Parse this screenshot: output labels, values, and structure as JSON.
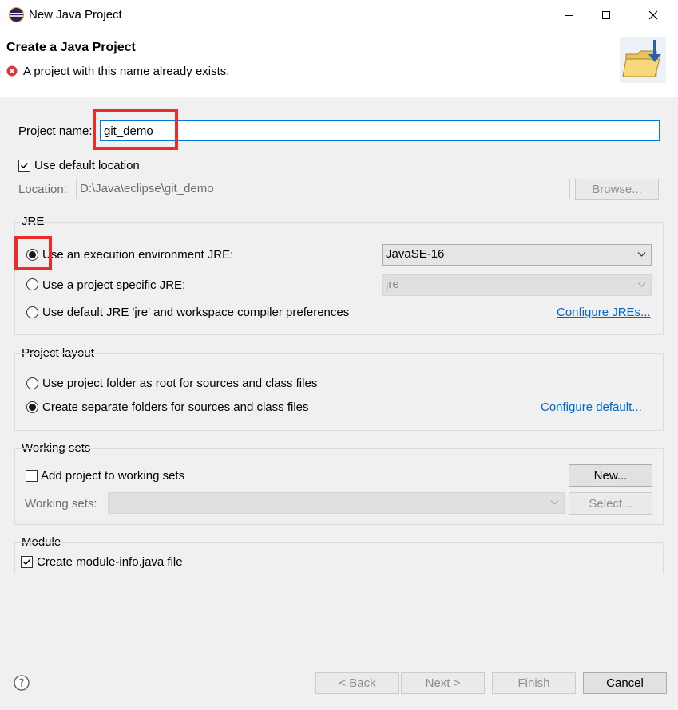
{
  "window": {
    "title": "New Java Project",
    "minimize_icon": "minimize-icon",
    "maximize_icon": "maximize-icon",
    "close_icon": "close-icon"
  },
  "banner": {
    "title": "Create a Java Project",
    "message": "A project with this name already exists.",
    "message_icon": "error-icon",
    "image_icon": "folder-wizard-icon"
  },
  "project": {
    "name_label": "Project name:",
    "name_value": "git_demo",
    "use_default_location_label": "Use default location",
    "use_default_location_checked": true,
    "location_label": "Location:",
    "location_value": "D:\\Java\\eclipse\\git_demo",
    "browse_label": "Browse..."
  },
  "jre": {
    "group_title": "JRE",
    "options": [
      {
        "label": "Use an execution environment JRE:",
        "selected": true
      },
      {
        "label": "Use a project specific JRE:",
        "selected": false
      },
      {
        "label": "Use default JRE 'jre' and workspace compiler preferences",
        "selected": false
      }
    ],
    "execution_env_value": "JavaSE-16",
    "project_specific_value": "jre",
    "configure_link": "Configure JREs..."
  },
  "layout": {
    "group_title": "Project layout",
    "options": [
      {
        "label": "Use project folder as root for sources and class files",
        "selected": false
      },
      {
        "label": "Create separate folders for sources and class files",
        "selected": true
      }
    ],
    "configure_link": "Configure default..."
  },
  "working_sets": {
    "group_title": "Working sets",
    "add_label": "Add project to working sets",
    "add_checked": false,
    "new_label": "New...",
    "sets_label": "Working sets:",
    "sets_value": "",
    "select_label": "Select..."
  },
  "module": {
    "group_title": "Module",
    "create_label": "Create module-info.java file",
    "create_checked": true
  },
  "footer": {
    "help_icon": "help-icon",
    "back_label": "< Back",
    "next_label": "Next >",
    "finish_label": "Finish",
    "cancel_label": "Cancel"
  },
  "colors": {
    "annotation": "#ee2a2a",
    "link": "#0066cc",
    "focus_border": "#0078d7"
  }
}
